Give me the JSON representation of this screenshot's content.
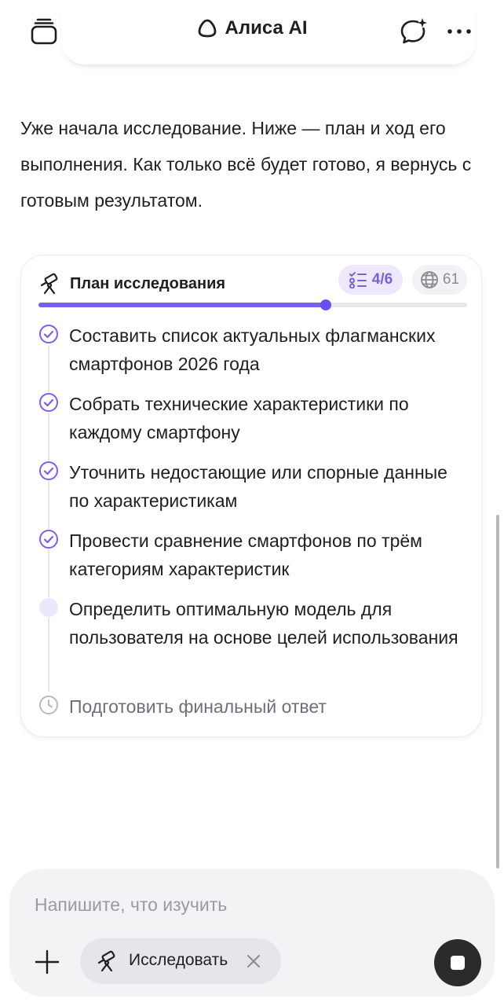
{
  "header": {
    "title": "Алиса AI",
    "menu_icon": "stack-icon",
    "logo_icon": "alice-ring-icon",
    "new_chat_icon": "new-chat-sparkle-icon",
    "more_icon": "more-dots-icon"
  },
  "message": {
    "text": "Уже начала исследование. Ниже — план и ход его выполнения. Как только всё будет готово, я вернусь с готовым результатом."
  },
  "plan": {
    "title": "План исследования",
    "title_icon": "telescope-icon",
    "progress_label": "4/6",
    "progress_icon": "checklist-icon",
    "progress_fraction": 0.67,
    "sources_count": "61",
    "sources_icon": "globe-icon",
    "accent_color": "#7a5ef0",
    "steps": [
      {
        "text": "Составить список актуальных флагманских смартфонов 2026 года",
        "status": "done"
      },
      {
        "text": "Собрать технические характеристики по каждому смартфону",
        "status": "done"
      },
      {
        "text": "Уточнить недостающие или спорные данные по характеристикам",
        "status": "done"
      },
      {
        "text": "Провести сравнение смартфонов по трём категориям характеристик",
        "status": "done"
      },
      {
        "text": "Определить оптимальную модель для пользователя на основе целей использования",
        "status": "in-progress"
      },
      {
        "text": "Подготовить финальный ответ",
        "status": "pending"
      }
    ]
  },
  "composer": {
    "placeholder": "Напишите, что изучить",
    "value": "",
    "chip_label": "Исследовать",
    "chip_icon": "telescope-icon",
    "add_icon": "plus-icon",
    "close_icon": "close-icon",
    "stop_icon": "stop-icon"
  }
}
